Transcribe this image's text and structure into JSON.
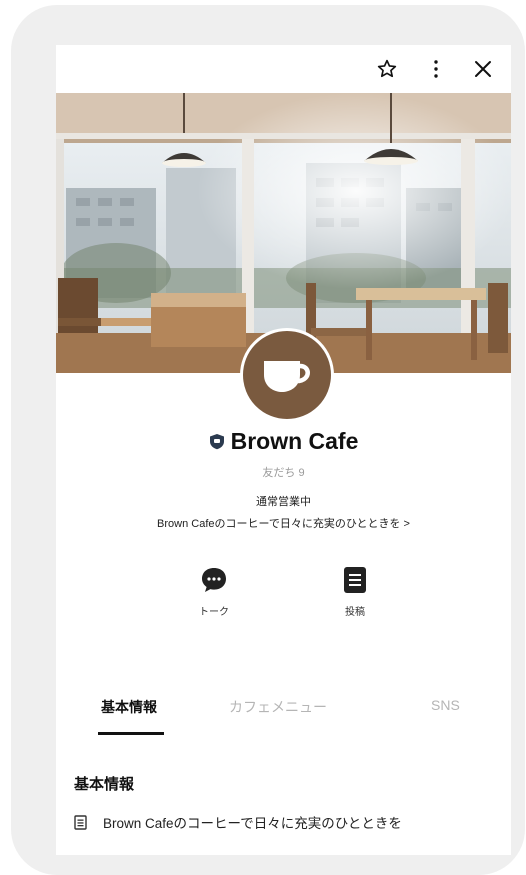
{
  "profile": {
    "name": "Brown Cafe",
    "friends": "友だち 9",
    "status": "通常営業中",
    "description": "Brown Cafeのコーヒーで日々に充実のひとときを >"
  },
  "actions": {
    "talk_label": "トーク",
    "post_label": "投稿"
  },
  "tabs": [
    {
      "label": "基本情報",
      "active": true
    },
    {
      "label": "カフェメニュー",
      "active": false
    },
    {
      "label": "SNS",
      "active": false
    }
  ],
  "section": {
    "title": "基本情報",
    "row_text": "Brown Cafeのコーヒーで日々に充実のひとときを"
  },
  "icons": {
    "top": [
      "star-icon",
      "more-vertical-icon",
      "close-icon"
    ],
    "badge": "shield-badge-icon",
    "avatar": "coffee-cup-icon",
    "talk": "speech-bubble-icon",
    "post": "document-icon",
    "row": "list-document-icon"
  },
  "colors": {
    "avatar_bg": "#7a5a3f",
    "tab_active": "#111111",
    "tab_inactive": "#b5b5b5",
    "badge": "#2b3a4f"
  }
}
